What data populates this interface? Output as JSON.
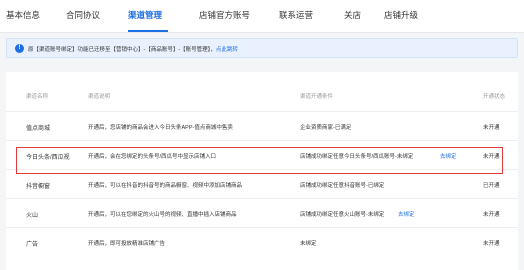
{
  "tabs": [
    {
      "label": "基本信息",
      "active": false
    },
    {
      "label": "合同协议",
      "active": false
    },
    {
      "label": "渠道管理",
      "active": true
    },
    {
      "label": "店铺官方账号",
      "active": false
    },
    {
      "label": "联系运营",
      "active": false
    },
    {
      "label": "关店",
      "active": false
    },
    {
      "label": "店铺升级",
      "active": false
    }
  ],
  "notice": {
    "icon": "info-icon",
    "text": "原【渠道账号绑定】功能已迁移至【营销中心】-【商品账号】-【账号管理】，",
    "link": "点此跳转"
  },
  "table": {
    "headers": [
      "渠道名称",
      "渠道说明",
      "渠道开通条件",
      "开通状态"
    ],
    "rows": [
      {
        "name": "值点商城",
        "desc": "开通后，您店铺的商品会进入今日头条APP-值点商城中售卖",
        "cond": "企业资质商家-已满足",
        "cond_link": "",
        "status": "未开通"
      },
      {
        "name": "今日头条/西瓜视",
        "desc": "开通后，会在您绑定的头条号/西瓜号中显示店铺入口",
        "cond": "店铺成功绑定任意今日头条号/西瓜账号-未绑定",
        "cond_link": "去绑定",
        "status": "未开通"
      },
      {
        "name": "抖音橱窗",
        "desc": "开通后，可以在抖音的抖音号的商品橱窗、视频中添加店铺商品",
        "cond": "店铺成功绑定任意抖音账号-已绑定",
        "cond_link": "",
        "status": "已开通"
      },
      {
        "name": "火山",
        "desc": "开通后，可以在您绑定的火山号的视频、直播中插入店铺商品",
        "cond": "店铺成功绑定任意火山账号-未绑定",
        "cond_link": "去绑定",
        "status": "未开通"
      },
      {
        "name": "广告",
        "desc": "开通后，即可投放精准店铺广告",
        "cond": "未绑定",
        "cond_link": "",
        "status": "未开通"
      }
    ]
  },
  "colors": {
    "accent": "#1f6fe5",
    "highlight": "#e03a3a",
    "notice_bg": "#e8f1fd"
  }
}
